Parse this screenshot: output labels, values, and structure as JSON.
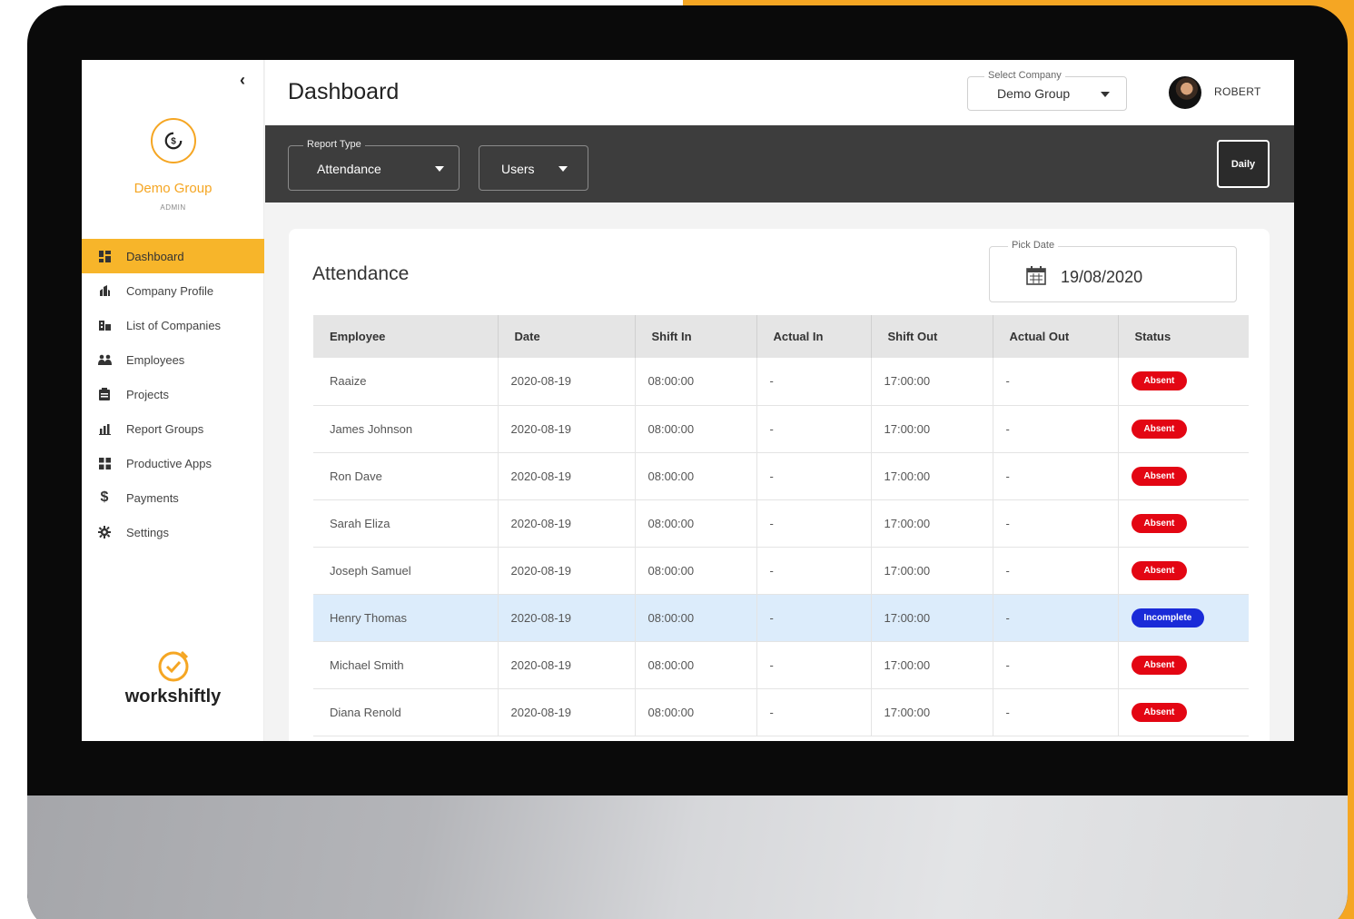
{
  "colors": {
    "accent": "#f5a623",
    "absent": "#e30613",
    "incomplete": "#1a2bd8",
    "filterbar": "#3d3d3d",
    "highlight": "#dcecfb"
  },
  "sidebar": {
    "org_name": "Demo Group",
    "role": "ADMIN",
    "brand": "workshiftly",
    "items": [
      {
        "label": "Dashboard",
        "icon": "dashboard-icon",
        "active": true
      },
      {
        "label": "Company Profile",
        "icon": "company-icon",
        "active": false
      },
      {
        "label": "List of Companies",
        "icon": "companies-list-icon",
        "active": false
      },
      {
        "label": "Employees",
        "icon": "people-icon",
        "active": false
      },
      {
        "label": "Projects",
        "icon": "clipboard-icon",
        "active": false
      },
      {
        "label": "Report Groups",
        "icon": "report-icon",
        "active": false
      },
      {
        "label": "Productive Apps",
        "icon": "apps-icon",
        "active": false
      },
      {
        "label": "Payments",
        "icon": "dollar-icon",
        "active": false
      },
      {
        "label": "Settings",
        "icon": "gear-icon",
        "active": false
      }
    ]
  },
  "header": {
    "title": "Dashboard",
    "company_label": "Select Company",
    "company_value": "Demo Group",
    "user": "ROBERT"
  },
  "filters": {
    "report_type_label": "Report Type",
    "report_type_value": "Attendance",
    "scope_value": "Users",
    "period_button": "Daily"
  },
  "attendance": {
    "title": "Attendance",
    "pick_date_label": "Pick Date",
    "pick_date_value": "19/08/2020",
    "columns": [
      "Employee",
      "Date",
      "Shift In",
      "Actual In",
      "Shift Out",
      "Actual Out",
      "Status"
    ],
    "rows": [
      {
        "employee": "Raaize",
        "date": "2020-08-19",
        "shift_in": "08:00:00",
        "actual_in": "-",
        "shift_out": "17:00:00",
        "actual_out": "-",
        "status": "Absent"
      },
      {
        "employee": "James Johnson",
        "date": "2020-08-19",
        "shift_in": "08:00:00",
        "actual_in": "-",
        "shift_out": "17:00:00",
        "actual_out": "-",
        "status": "Absent"
      },
      {
        "employee": "Ron Dave",
        "date": "2020-08-19",
        "shift_in": "08:00:00",
        "actual_in": "-",
        "shift_out": "17:00:00",
        "actual_out": "-",
        "status": "Absent"
      },
      {
        "employee": "Sarah Eliza",
        "date": "2020-08-19",
        "shift_in": "08:00:00",
        "actual_in": "-",
        "shift_out": "17:00:00",
        "actual_out": "-",
        "status": "Absent"
      },
      {
        "employee": "Joseph Samuel",
        "date": "2020-08-19",
        "shift_in": "08:00:00",
        "actual_in": "-",
        "shift_out": "17:00:00",
        "actual_out": "-",
        "status": "Absent"
      },
      {
        "employee": "Henry Thomas",
        "date": "2020-08-19",
        "shift_in": "08:00:00",
        "actual_in": "-",
        "shift_out": "17:00:00",
        "actual_out": "-",
        "status": "Incomplete"
      },
      {
        "employee": "Michael Smith",
        "date": "2020-08-19",
        "shift_in": "08:00:00",
        "actual_in": "-",
        "shift_out": "17:00:00",
        "actual_out": "-",
        "status": "Absent"
      },
      {
        "employee": "Diana Renold",
        "date": "2020-08-19",
        "shift_in": "08:00:00",
        "actual_in": "-",
        "shift_out": "17:00:00",
        "actual_out": "-",
        "status": "Absent"
      }
    ]
  }
}
